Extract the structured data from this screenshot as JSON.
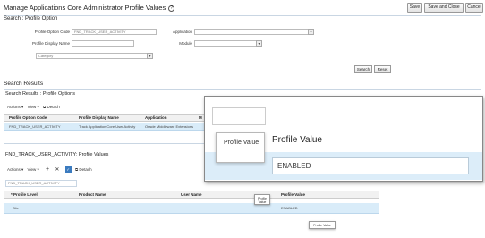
{
  "page": {
    "title": "Manage Applications Core Administrator Profile Values",
    "help_icon": "?"
  },
  "top_buttons": {
    "save": "Save",
    "save_close": "Save and Close",
    "cancel": "Cancel"
  },
  "search": {
    "header": "Search : Profile Option",
    "profile_option_code_label": "Profile Option Code",
    "profile_option_code_value": "FND_TRACK_USER_ACTIVITY",
    "application_label": "Application",
    "profile_display_name_label": "Profile Display Name",
    "module_label": "Module",
    "category_placeholder": "Category",
    "search_button": "Search",
    "reset_button": "Reset"
  },
  "results": {
    "title": "Search Results",
    "sub_header": "Search Results : Profile Options",
    "actions": "Actions",
    "view": "View",
    "detach": "Detach",
    "columns": [
      "Profile Option Code",
      "Profile Display Name",
      "Application",
      "M"
    ],
    "row": [
      "FND_TRACK_USER_ACTIVITY",
      "Track Application Core User Activity",
      "Oracle Middleware Extensions",
      ""
    ]
  },
  "values": {
    "header": "FND_TRACK_USER_ACTIVITY: Profile Values",
    "actions": "Actions",
    "view": "View",
    "detach": "Detach",
    "code_chip": "FND_TRACK_USER_ACTIVITY",
    "columns": [
      "* Profile Level",
      "Product Name",
      "User Name",
      "Profile Value"
    ],
    "row": [
      "Site",
      "",
      "",
      "ENABLED"
    ],
    "tooltip_small": "Profile Value",
    "tooltip_bottom": "Profile Value"
  },
  "zoom": {
    "title": "Profile Value",
    "tooltip": "Profile Value",
    "value": "ENABLED"
  }
}
